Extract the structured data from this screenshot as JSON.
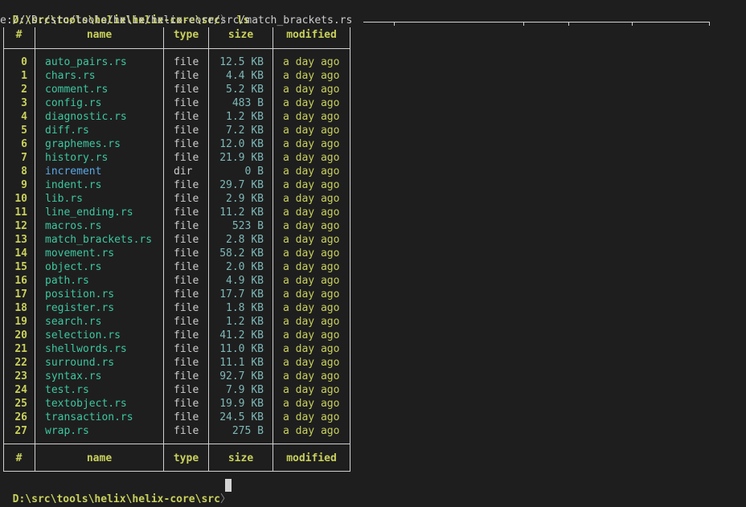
{
  "terminal": {
    "prompt_path": "D:\\src\\tools\\helix\\helix-core\\src",
    "prompt_separator": "〉",
    "command": "ls",
    "uri_line": "e:///D:/src/tools/helix/helix-core/src/match_brackets.rs"
  },
  "table": {
    "headers": {
      "index": "#",
      "name": "name",
      "type": "type",
      "size": "size",
      "modified": "modified"
    },
    "rows": [
      {
        "index": "0",
        "name": "auto_pairs.rs",
        "type": "file",
        "size": "12.5 KB",
        "modified": "a day ago",
        "kind": "file"
      },
      {
        "index": "1",
        "name": "chars.rs",
        "type": "file",
        "size": "4.4 KB",
        "modified": "a day ago",
        "kind": "file"
      },
      {
        "index": "2",
        "name": "comment.rs",
        "type": "file",
        "size": "5.2 KB",
        "modified": "a day ago",
        "kind": "file"
      },
      {
        "index": "3",
        "name": "config.rs",
        "type": "file",
        "size": "483 B",
        "modified": "a day ago",
        "kind": "file"
      },
      {
        "index": "4",
        "name": "diagnostic.rs",
        "type": "file",
        "size": "1.2 KB",
        "modified": "a day ago",
        "kind": "file"
      },
      {
        "index": "5",
        "name": "diff.rs",
        "type": "file",
        "size": "7.2 KB",
        "modified": "a day ago",
        "kind": "file"
      },
      {
        "index": "6",
        "name": "graphemes.rs",
        "type": "file",
        "size": "12.0 KB",
        "modified": "a day ago",
        "kind": "file"
      },
      {
        "index": "7",
        "name": "history.rs",
        "type": "file",
        "size": "21.9 KB",
        "modified": "a day ago",
        "kind": "file"
      },
      {
        "index": "8",
        "name": "increment",
        "type": "dir",
        "size": "0 B",
        "modified": "a day ago",
        "kind": "dir"
      },
      {
        "index": "9",
        "name": "indent.rs",
        "type": "file",
        "size": "29.7 KB",
        "modified": "a day ago",
        "kind": "file"
      },
      {
        "index": "10",
        "name": "lib.rs",
        "type": "file",
        "size": "2.9 KB",
        "modified": "a day ago",
        "kind": "file"
      },
      {
        "index": "11",
        "name": "line_ending.rs",
        "type": "file",
        "size": "11.2 KB",
        "modified": "a day ago",
        "kind": "file"
      },
      {
        "index": "12",
        "name": "macros.rs",
        "type": "file",
        "size": "523 B",
        "modified": "a day ago",
        "kind": "file"
      },
      {
        "index": "13",
        "name": "match_brackets.rs",
        "type": "file",
        "size": "2.8 KB",
        "modified": "a day ago",
        "kind": "file"
      },
      {
        "index": "14",
        "name": "movement.rs",
        "type": "file",
        "size": "58.2 KB",
        "modified": "a day ago",
        "kind": "file"
      },
      {
        "index": "15",
        "name": "object.rs",
        "type": "file",
        "size": "2.0 KB",
        "modified": "a day ago",
        "kind": "file"
      },
      {
        "index": "16",
        "name": "path.rs",
        "type": "file",
        "size": "4.9 KB",
        "modified": "a day ago",
        "kind": "file"
      },
      {
        "index": "17",
        "name": "position.rs",
        "type": "file",
        "size": "17.7 KB",
        "modified": "a day ago",
        "kind": "file"
      },
      {
        "index": "18",
        "name": "register.rs",
        "type": "file",
        "size": "1.8 KB",
        "modified": "a day ago",
        "kind": "file"
      },
      {
        "index": "19",
        "name": "search.rs",
        "type": "file",
        "size": "1.2 KB",
        "modified": "a day ago",
        "kind": "file"
      },
      {
        "index": "20",
        "name": "selection.rs",
        "type": "file",
        "size": "41.2 KB",
        "modified": "a day ago",
        "kind": "file"
      },
      {
        "index": "21",
        "name": "shellwords.rs",
        "type": "file",
        "size": "11.0 KB",
        "modified": "a day ago",
        "kind": "file"
      },
      {
        "index": "22",
        "name": "surround.rs",
        "type": "file",
        "size": "11.1 KB",
        "modified": "a day ago",
        "kind": "file"
      },
      {
        "index": "23",
        "name": "syntax.rs",
        "type": "file",
        "size": "92.7 KB",
        "modified": "a day ago",
        "kind": "file"
      },
      {
        "index": "24",
        "name": "test.rs",
        "type": "file",
        "size": "7.9 KB",
        "modified": "a day ago",
        "kind": "file"
      },
      {
        "index": "25",
        "name": "textobject.rs",
        "type": "file",
        "size": "19.9 KB",
        "modified": "a day ago",
        "kind": "file"
      },
      {
        "index": "26",
        "name": "transaction.rs",
        "type": "file",
        "size": "24.5 KB",
        "modified": "a day ago",
        "kind": "file"
      },
      {
        "index": "27",
        "name": "wrap.rs",
        "type": "file",
        "size": "275 B",
        "modified": "a day ago",
        "kind": "file"
      }
    ]
  },
  "colors": {
    "background": "#1e1e1e",
    "prompt": "#c9d05c",
    "file_name": "#3dc7a0",
    "dir_name": "#5aa8e6",
    "size": "#7fb8b8",
    "modified": "#c9d05c"
  }
}
